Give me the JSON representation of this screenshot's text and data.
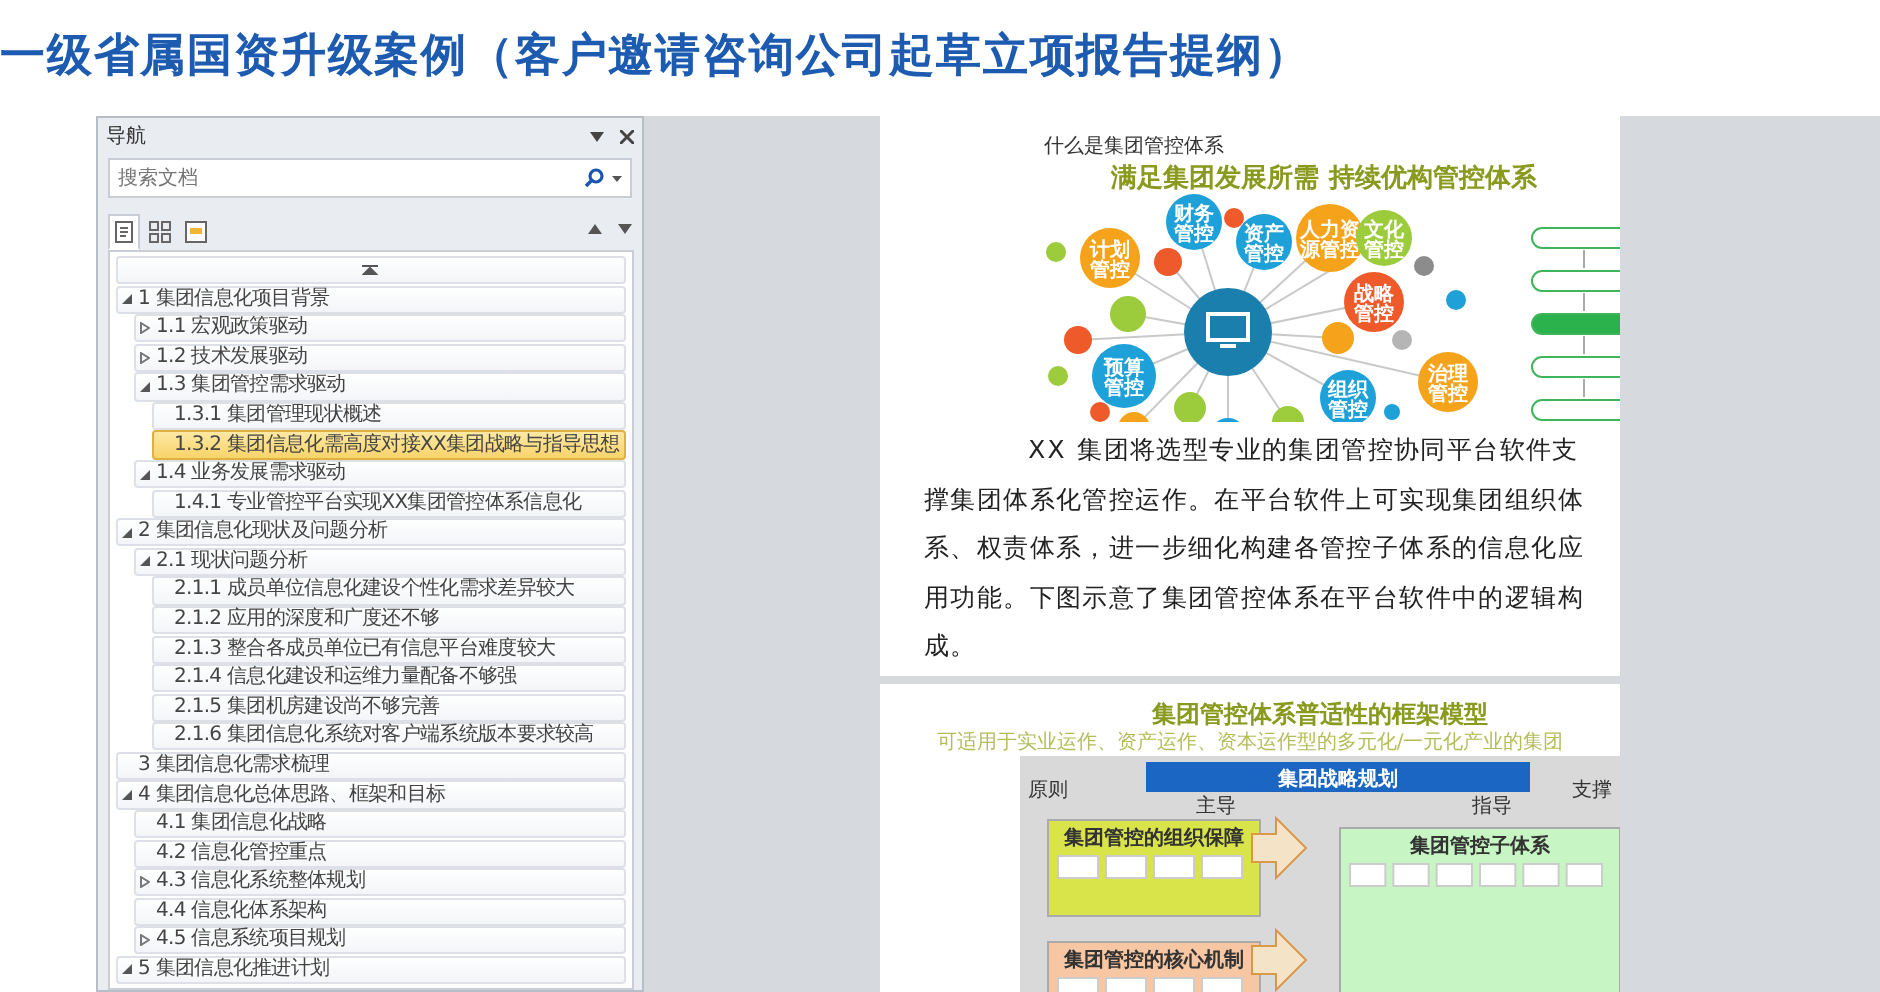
{
  "header": {
    "title": "一级省属国资升级案例（客户邀请咨询公司起草立项报告提纲）"
  },
  "nav": {
    "title": "导航",
    "search": {
      "placeholder": "搜索文档"
    },
    "view_tabs": [
      {
        "kind": "headings",
        "selected": true
      },
      {
        "kind": "pages",
        "selected": false
      },
      {
        "kind": "results",
        "selected": false
      }
    ],
    "tree": [
      {
        "label": "1 集团信息化项目背景",
        "expanded": true,
        "selected": false,
        "children": [
          {
            "label": "1.1 宏观政策驱动",
            "expanded": false,
            "selected": false
          },
          {
            "label": "1.2 技术发展驱动",
            "expanded": false,
            "selected": false
          },
          {
            "label": "1.3 集团管控需求驱动",
            "expanded": true,
            "selected": false,
            "children": [
              {
                "label": "1.3.1 集团管理现状概述",
                "selected": false
              },
              {
                "label": "1.3.2 集团信息化需高度对接XX集团战略与指导思想",
                "selected": true
              }
            ]
          },
          {
            "label": "1.4 业务发展需求驱动",
            "expanded": true,
            "selected": false,
            "children": [
              {
                "label": "1.4.1 专业管控平台实现XX集团管控体系信息化",
                "selected": false
              }
            ]
          }
        ]
      },
      {
        "label": "2 集团信息化现状及问题分析",
        "expanded": true,
        "selected": false,
        "children": [
          {
            "label": "2.1 现状问题分析",
            "expanded": true,
            "selected": false,
            "children": [
              {
                "label": "2.1.1 成员单位信息化建设个性化需求差异较大",
                "selected": false
              },
              {
                "label": "2.1.2 应用的深度和广度还不够",
                "selected": false
              },
              {
                "label": "2.1.3 整合各成员单位已有信息平台难度较大",
                "selected": false
              },
              {
                "label": "2.1.4 信息化建设和运维力量配备不够强",
                "selected": false
              },
              {
                "label": "2.1.5 集团机房建设尚不够完善",
                "selected": false
              },
              {
                "label": "2.1.6 集团信息化系统对客户端系统版本要求较高",
                "selected": false
              }
            ]
          }
        ]
      },
      {
        "label": "3 集团信息化需求梳理",
        "selected": false
      },
      {
        "label": "4 集团信息化总体思路、框架和目标",
        "expanded": true,
        "selected": false,
        "children": [
          {
            "label": "4.1 集团信息化战略",
            "selected": false
          },
          {
            "label": "4.2 信息化管控重点",
            "selected": false
          },
          {
            "label": "4.3 信息化系统整体规划",
            "expanded": false,
            "selected": false
          },
          {
            "label": "4.4 信息化体系架构",
            "selected": false
          },
          {
            "label": "4.5 信息系统项目规划",
            "expanded": false,
            "selected": false
          }
        ]
      },
      {
        "label": "5 集团信息化推进计划",
        "expanded": true,
        "selected": false
      }
    ]
  },
  "document": {
    "page_1": {
      "caption": "什么是集团管控体系",
      "diagram_title": "满足集团发展所需  持续优构管控体系",
      "bubbles": [
        {
          "label": "计划管控",
          "color": "#f5a31a"
        },
        {
          "label": "财务管控",
          "color": "#1ea0d8"
        },
        {
          "label": "资产管控",
          "color": "#1ea0d8"
        },
        {
          "label": "人力资源管控",
          "color": "#f5a31a"
        },
        {
          "label": "文化管控",
          "color": "#9ccb3b"
        },
        {
          "label": "战略管控",
          "color": "#ee5a2a"
        },
        {
          "label": "预算管控",
          "color": "#1ea0d8"
        },
        {
          "label": "组织管控",
          "color": "#1ea0d8"
        },
        {
          "label": "治理管控",
          "color": "#f5a31a"
        },
        {
          "color": "#ee5a2a"
        },
        {
          "color": "#9ccb3b"
        },
        {
          "color": "#ee5a2a"
        },
        {
          "color": "#9ccb3b"
        },
        {
          "color": "#1ea0d8"
        },
        {
          "color": "#9ccb3b"
        },
        {
          "color": "#f5a31a"
        },
        {
          "color": "#f5a31a"
        },
        {
          "color": "#9ccb3b"
        },
        {
          "color": "#ee5a2a"
        },
        {
          "color": "#8c8c8c"
        },
        {
          "color": "#1ea0d8"
        },
        {
          "color": "#b5b5b5"
        },
        {
          "color": "#9ccb3b"
        },
        {
          "color": "#ee5a2a"
        },
        {
          "color": "#1ea0d8"
        }
      ],
      "flow_steps": [
        {
          "highlighted": false
        },
        {
          "highlighted": false
        },
        {
          "highlighted": true
        },
        {
          "highlighted": false
        },
        {
          "highlighted": false
        }
      ],
      "paragraph": "XX 集团将选型专业的集团管控协同平台软件支撑集团体系化管控运作。在平台软件上可实现集团组织体系、权责体系，进一步细化构建各管控子体系的信息化应用功能。下图示意了集团管控体系在平台软件中的逻辑构成。"
    },
    "page_2": {
      "diagram_title": "集团管控体系普适性的框架模型",
      "diagram_subtitle": "可适用于实业运作、资产运作、资本运作型的多元化/一元化产业的集团",
      "strategy_bar": "集团战略规划",
      "labels": [
        "原则",
        "主导",
        "指导",
        "支撑"
      ],
      "panels": [
        {
          "title": "集团管控的组织保障",
          "color": "#d9e34a"
        },
        {
          "title": "集团管控的核心机制",
          "color": "#f7c7a3"
        },
        {
          "title": "集团管控子体系",
          "color": "#c8f5c4"
        }
      ]
    }
  }
}
